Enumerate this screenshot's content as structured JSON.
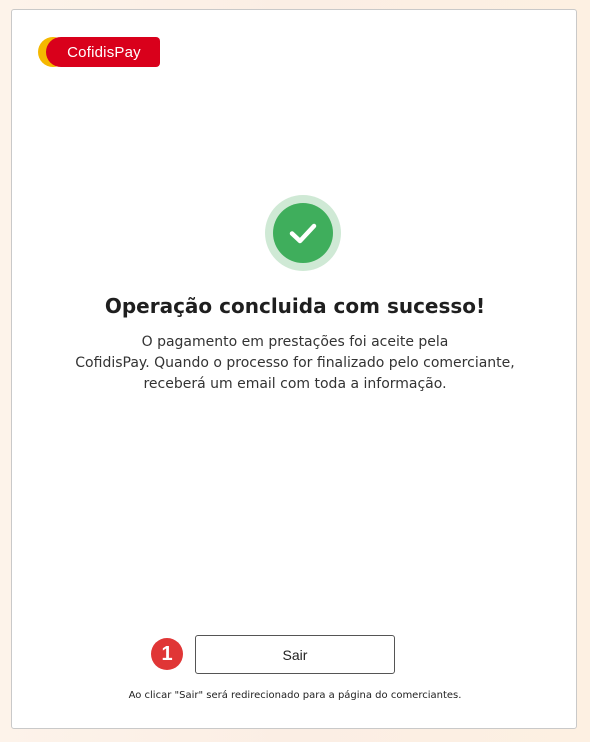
{
  "brand": {
    "logo_text": "CofidisPay",
    "colors": {
      "red": "#d9001b",
      "yellow": "#f5b800"
    }
  },
  "status": {
    "icon": "checkmark-icon",
    "color": "#3fae5c",
    "title": "Operação concluida com sucesso!",
    "message_lines": [
      "O pagamento em prestações foi aceite pela",
      "CofidisPay. Quando o processo for finalizado pelo comerciante,",
      "receberá um email com toda a informação."
    ]
  },
  "actions": {
    "step_number": "1",
    "exit_label": "Sair",
    "note": "Ao clicar \"Sair\" será redirecionado para a página do comerciantes."
  }
}
